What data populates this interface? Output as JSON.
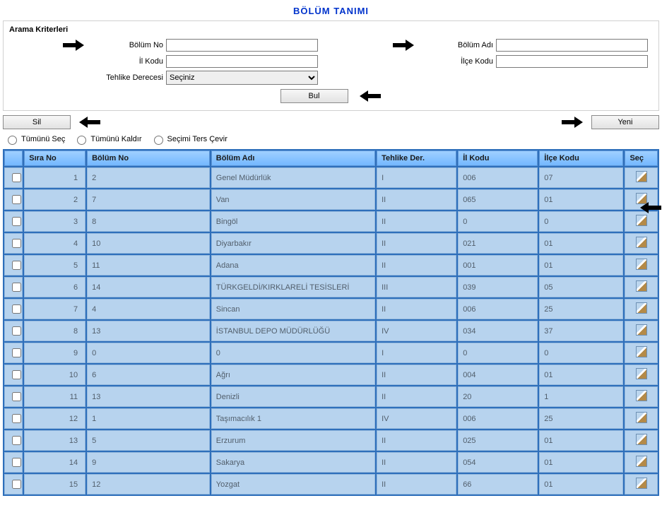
{
  "title": "BÖLÜM TANIMI",
  "criteria": {
    "heading": "Arama Kriterleri",
    "bolum_no_label": "Bölüm No",
    "bolum_no_value": "",
    "il_kodu_label": "İl Kodu",
    "il_kodu_value": "",
    "tehlike_label": "Tehlike Derecesi",
    "tehlike_select_value": "Seçiniz",
    "bolum_adi_label": "Bölüm Adı",
    "bolum_adi_value": "",
    "ilce_kodu_label": "İlçe Kodu",
    "ilce_kodu_value": "",
    "bul_label": "Bul"
  },
  "buttons": {
    "sil": "Sil",
    "yeni": "Yeni"
  },
  "selection": {
    "all": "Tümünü Seç",
    "none": "Tümünü Kaldır",
    "invert": "Seçimi Ters Çevir"
  },
  "columns": {
    "sira": "Sıra No",
    "bolum_no": "Bölüm No",
    "bolum_adi": "Bölüm Adı",
    "tehlike": "Tehlike Der.",
    "il": "İl Kodu",
    "ilce": "İlçe Kodu",
    "sec": "Seç"
  },
  "rows": [
    {
      "sira": "1",
      "bolum_no": "2",
      "bolum_adi": "Genel Müdürlük",
      "tehlike": "I",
      "il": "006",
      "ilce": "07"
    },
    {
      "sira": "2",
      "bolum_no": "7",
      "bolum_adi": "Van",
      "tehlike": "II",
      "il": "065",
      "ilce": "01"
    },
    {
      "sira": "3",
      "bolum_no": "8",
      "bolum_adi": "Bingöl",
      "tehlike": "II",
      "il": "0",
      "ilce": "0"
    },
    {
      "sira": "4",
      "bolum_no": "10",
      "bolum_adi": "Diyarbakır",
      "tehlike": "II",
      "il": "021",
      "ilce": "01"
    },
    {
      "sira": "5",
      "bolum_no": "11",
      "bolum_adi": "Adana",
      "tehlike": "II",
      "il": "001",
      "ilce": "01"
    },
    {
      "sira": "6",
      "bolum_no": "14",
      "bolum_adi": "TÜRKGELDİ/KIRKLARELİ TESİSLERİ",
      "tehlike": "III",
      "il": "039",
      "ilce": "05"
    },
    {
      "sira": "7",
      "bolum_no": "4",
      "bolum_adi": "Sincan",
      "tehlike": "II",
      "il": "006",
      "ilce": "25"
    },
    {
      "sira": "8",
      "bolum_no": "13",
      "bolum_adi": "İSTANBUL DEPO MÜDÜRLÜĞÜ",
      "tehlike": "IV",
      "il": "034",
      "ilce": "37"
    },
    {
      "sira": "9",
      "bolum_no": "0",
      "bolum_adi": "0",
      "tehlike": "I",
      "il": "0",
      "ilce": "0"
    },
    {
      "sira": "10",
      "bolum_no": "6",
      "bolum_adi": "Ağrı",
      "tehlike": "II",
      "il": "004",
      "ilce": "01"
    },
    {
      "sira": "11",
      "bolum_no": "13",
      "bolum_adi": "Denizli",
      "tehlike": "II",
      "il": "20",
      "ilce": "1"
    },
    {
      "sira": "12",
      "bolum_no": "1",
      "bolum_adi": "Taşımacılık 1",
      "tehlike": "IV",
      "il": "006",
      "ilce": "25"
    },
    {
      "sira": "13",
      "bolum_no": "5",
      "bolum_adi": "Erzurum",
      "tehlike": "II",
      "il": "025",
      "ilce": "01"
    },
    {
      "sira": "14",
      "bolum_no": "9",
      "bolum_adi": "Sakarya",
      "tehlike": "II",
      "il": "054",
      "ilce": "01"
    },
    {
      "sira": "15",
      "bolum_no": "12",
      "bolum_adi": "Yozgat",
      "tehlike": "II",
      "il": "66",
      "ilce": "01"
    }
  ]
}
